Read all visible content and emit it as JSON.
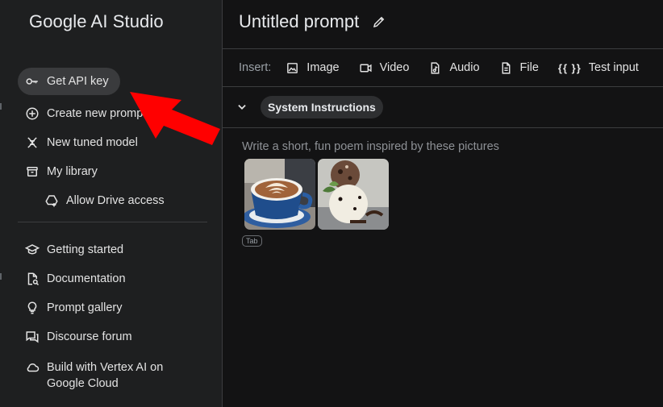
{
  "brand": {
    "name": "Google AI Studio"
  },
  "sidebar": {
    "primary": [
      {
        "label": "Get API key",
        "icon": "key-icon"
      },
      {
        "label": "Create new prompt",
        "icon": "plus-circle-icon"
      },
      {
        "label": "New tuned model",
        "icon": "tuned-model-icon"
      },
      {
        "label": "My library",
        "icon": "library-icon"
      },
      {
        "label": "Allow Drive access",
        "icon": "drive-add-icon"
      }
    ],
    "secondary": [
      {
        "label": "Getting started",
        "icon": "graduation-cap-icon"
      },
      {
        "label": "Documentation",
        "icon": "doc-search-icon"
      },
      {
        "label": "Prompt gallery",
        "icon": "lightbulb-icon"
      },
      {
        "label": "Discourse forum",
        "icon": "forum-icon"
      },
      {
        "label": "Build with Vertex AI on",
        "label_line2": "Google Cloud",
        "icon": "cloud-icon"
      }
    ]
  },
  "main": {
    "title": "Untitled prompt",
    "toolbar": {
      "insert_label": "Insert:",
      "buttons": [
        {
          "label": "Image",
          "icon": "image-icon"
        },
        {
          "label": "Video",
          "icon": "video-icon"
        },
        {
          "label": "Audio",
          "icon": "audio-icon"
        },
        {
          "label": "File",
          "icon": "file-icon"
        },
        {
          "label": "Test input",
          "glyph": "{{ }}",
          "icon": "test-input-icon"
        }
      ]
    },
    "system_instructions_label": "System Instructions",
    "prompt_placeholder": "Write a short, fun poem inspired by these pictures",
    "tab_hint": "Tab",
    "images": [
      {
        "name": "latte-art-image"
      },
      {
        "name": "ice-cream-image"
      }
    ]
  },
  "colors": {
    "sidebar_bg": "#1e1f20",
    "main_bg": "#131314",
    "pill_bg": "#3a3b3d",
    "annotation_arrow": "#ff0000"
  }
}
